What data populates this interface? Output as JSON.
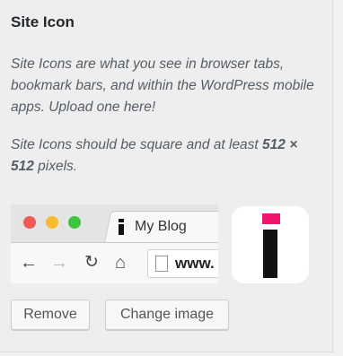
{
  "section": {
    "title": "Site Icon",
    "description": "Site Icons are what you see in browser tabs, bookmark bars, and within the WordPress mobile apps. Upload one here!",
    "requirement_prefix": "Site Icons should be square and at least ",
    "requirement_size": "512 × 512",
    "requirement_suffix": " pixels."
  },
  "preview": {
    "tab_title": "My Blog",
    "url_text": "www.",
    "icons": {
      "back": "arrow-left-icon",
      "forward": "arrow-right-icon",
      "reload": "reload-icon",
      "home": "home-icon",
      "page": "page-icon"
    }
  },
  "buttons": {
    "remove": "Remove",
    "change": "Change image"
  },
  "colors": {
    "icon_accent": "#f0146c",
    "icon_body": "#111111"
  }
}
